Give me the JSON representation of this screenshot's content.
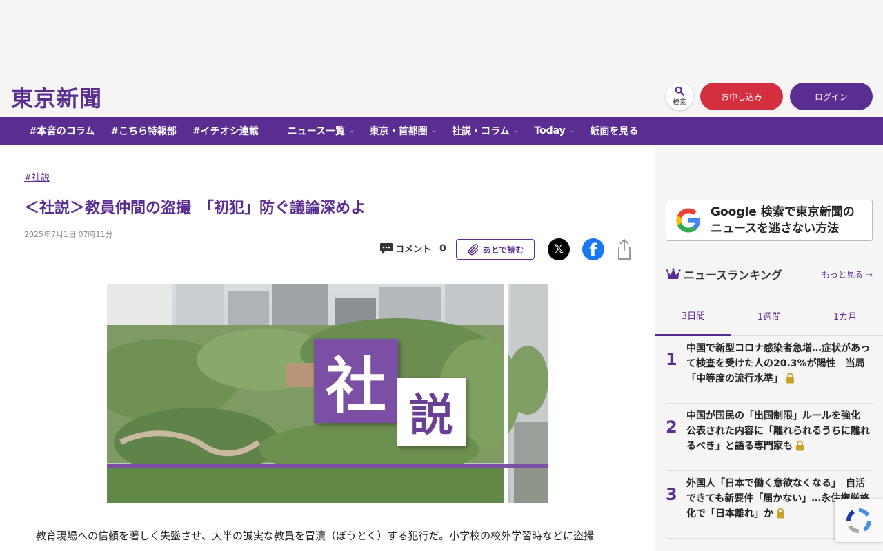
{
  "header": {
    "logo": "東京新聞",
    "search_label": "検索",
    "apply_label": "お申し込み",
    "login_label": "ログイン"
  },
  "nav": {
    "items": [
      {
        "label": "#本音のコラム"
      },
      {
        "label": "#こちら特報部"
      },
      {
        "label": "#イチオシ連載"
      },
      {
        "label": "ニュース一覧"
      },
      {
        "label": "東京・首都圏"
      },
      {
        "label": "社説・コラム"
      },
      {
        "label": "Today"
      },
      {
        "label": "紙面を見る"
      }
    ]
  },
  "article": {
    "tag": "#社説",
    "title": "＜社説＞教員仲間の盗撮　「初犯」防ぐ議論深めよ",
    "date": "2025年7月1日 07時11分",
    "comment_label": "コメント",
    "comment_count": "0",
    "read_later_label": "あとで読む",
    "hero_kanji_1": "社",
    "hero_kanji_2": "説",
    "lead": "教育現場への信頼を著しく失墜させ、大半の誠実な教員を冒瀆（ぼうとく）する犯行だ。小学校の校外学習時などに盗撮"
  },
  "sidebar": {
    "google_banner": {
      "line1": "Google 検索で東京新聞の",
      "line2": "ニュースを逃さない方法"
    },
    "ranking": {
      "title": "ニュースランキング",
      "more_label": "もっと見る",
      "tabs": [
        {
          "label": "3日間"
        },
        {
          "label": "1週間"
        },
        {
          "label": "1カ月"
        }
      ],
      "items": [
        {
          "rank": "1",
          "text": "中国で新型コロナ感染者急増…症状があって検査を受けた人の20.3%が陽性　当局「中等度の流行水準」"
        },
        {
          "rank": "2",
          "text": "中国が国民の「出国制限」ルールを強化　公表された内容に「離れられるうちに離れるべき」と語る専門家も"
        },
        {
          "rank": "3",
          "text": "外国人「日本で働く意欲なくなる」　自活できても新要件「届かない」…永住権厳格化で「日本離れ」か"
        }
      ]
    }
  },
  "colors": {
    "brand_purple": "#5a2d91",
    "apply_red": "#d32f3f"
  }
}
